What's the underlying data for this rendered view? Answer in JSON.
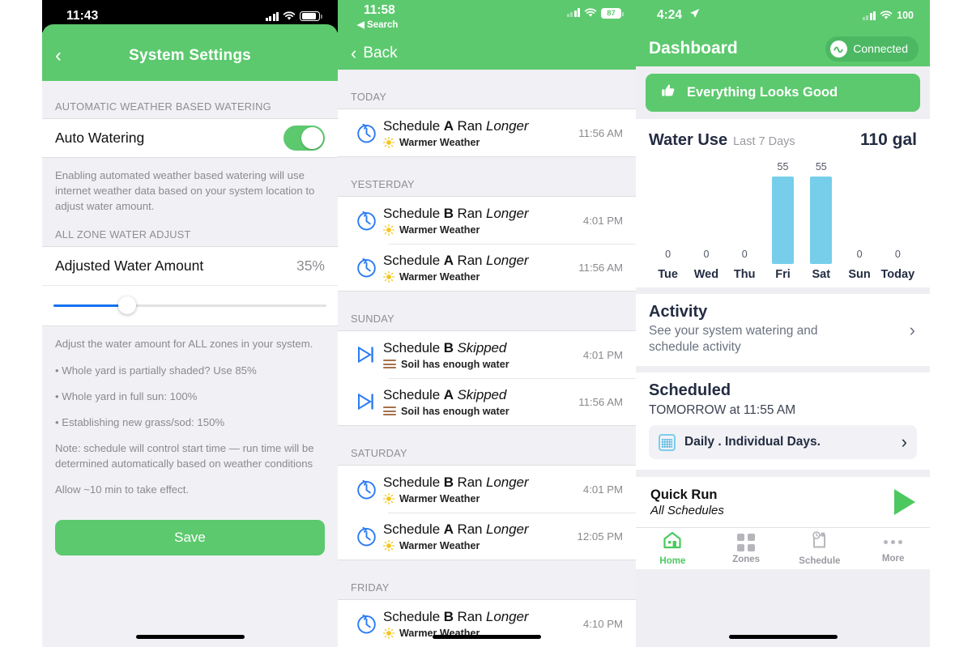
{
  "panel1": {
    "status": {
      "time": "11:43",
      "signal_icon": "cellular-signal-icon",
      "wifi_icon": "wifi-icon",
      "battery_icon": "battery-icon"
    },
    "nav": {
      "back_icon": "chevron-left-icon",
      "title": "System Settings"
    },
    "section1_header": "AUTOMATIC WEATHER BASED WATERING",
    "auto_watering": {
      "label": "Auto Watering",
      "toggle_state": "on"
    },
    "help1": "Enabling automated weather based watering will use internet weather data based on your system location to adjust water amount.",
    "section2_header": "ALL ZONE WATER ADJUST",
    "adjust": {
      "label": "Adjusted Water Amount",
      "value": "35%",
      "slider_percent": 27
    },
    "help_lines": [
      "Adjust the water amount for ALL zones in your system.",
      "• Whole yard is partially shaded? Use 85%",
      "• Whole yard in full sun: 100%",
      "• Establishing new grass/sod: 150%",
      "Note: schedule will control start time — run time will be determined automatically based on weather conditions",
      "Allow ~10 min to take effect."
    ],
    "save_label": "Save"
  },
  "panel2": {
    "status": {
      "time": "11:58",
      "back_app": "◀ Search",
      "battery_percent": "87"
    },
    "nav": {
      "back_icon": "chevron-left-icon",
      "back_label": "Back"
    },
    "groups": [
      {
        "day": "TODAY",
        "events": [
          {
            "icon": "clock-ran-longer-icon",
            "schedule": "Schedule",
            "name": "A",
            "action": "Ran",
            "state": "Longer",
            "reason": "Warmer Weather",
            "reason_icon": "sun-icon",
            "time": "11:56 AM"
          }
        ]
      },
      {
        "day": "YESTERDAY",
        "events": [
          {
            "icon": "clock-ran-longer-icon",
            "schedule": "Schedule",
            "name": "B",
            "action": "Ran",
            "state": "Longer",
            "reason": "Warmer Weather",
            "reason_icon": "sun-icon",
            "time": "4:01 PM"
          },
          {
            "icon": "clock-ran-longer-icon",
            "schedule": "Schedule",
            "name": "A",
            "action": "Ran",
            "state": "Longer",
            "reason": "Warmer Weather",
            "reason_icon": "sun-icon",
            "time": "11:56 AM"
          }
        ]
      },
      {
        "day": "SUNDAY",
        "events": [
          {
            "icon": "skip-forward-icon",
            "schedule": "Schedule",
            "name": "B",
            "action": "",
            "state": "Skipped",
            "reason": "Soil has enough water",
            "reason_icon": "soil-icon",
            "time": "4:01 PM"
          },
          {
            "icon": "skip-forward-icon",
            "schedule": "Schedule",
            "name": "A",
            "action": "",
            "state": "Skipped",
            "reason": "Soil has enough water",
            "reason_icon": "soil-icon",
            "time": "11:56 AM"
          }
        ]
      },
      {
        "day": "SATURDAY",
        "events": [
          {
            "icon": "clock-ran-longer-icon",
            "schedule": "Schedule",
            "name": "B",
            "action": "Ran",
            "state": "Longer",
            "reason": "Warmer Weather",
            "reason_icon": "sun-icon",
            "time": "4:01 PM"
          },
          {
            "icon": "clock-ran-longer-icon",
            "schedule": "Schedule",
            "name": "A",
            "action": "Ran",
            "state": "Longer",
            "reason": "Warmer Weather",
            "reason_icon": "sun-icon",
            "time": "12:05 PM"
          }
        ]
      },
      {
        "day": "FRIDAY",
        "events": [
          {
            "icon": "clock-ran-longer-icon",
            "schedule": "Schedule",
            "name": "B",
            "action": "Ran",
            "state": "Longer",
            "reason": "Warmer Weather",
            "reason_icon": "sun-icon",
            "time": "4:10 PM"
          }
        ]
      }
    ]
  },
  "panel3": {
    "status": {
      "time": "4:24",
      "location_icon": "location-arrow-icon",
      "battery_percent": "100"
    },
    "nav": {
      "title": "Dashboard",
      "connected_label": "Connected",
      "connected_icon": "wave-icon"
    },
    "banner": {
      "icon": "thumbs-up-icon",
      "text": "Everything Looks Good"
    },
    "water_use": {
      "title": "Water Use",
      "subtitle": "Last 7 Days",
      "total": "110 gal"
    },
    "activity": {
      "title": "Activity",
      "desc": "See your system watering and schedule activity",
      "chevron_icon": "chevron-right-icon"
    },
    "scheduled": {
      "title": "Scheduled",
      "when": "TOMORROW at 11:55 AM",
      "item_label": "Daily . Individual Days.",
      "item_icon": "calendar-icon",
      "chevron_icon": "chevron-right-icon"
    },
    "quick_run": {
      "title": "Quick Run",
      "subtitle": "All Schedules",
      "play_icon": "play-icon"
    },
    "tabs": [
      {
        "label": "Home",
        "icon": "home-icon",
        "active": true
      },
      {
        "label": "Zones",
        "icon": "grid-icon",
        "active": false
      },
      {
        "label": "Schedule",
        "icon": "schedule-clock-icon",
        "active": false
      },
      {
        "label": "More",
        "icon": "ellipsis-icon",
        "active": false
      }
    ]
  },
  "chart_data": {
    "type": "bar",
    "title": "Water Use",
    "subtitle": "Last 7 Days",
    "categories": [
      "Tue",
      "Wed",
      "Thu",
      "Fri",
      "Sat",
      "Sun",
      "Today"
    ],
    "values": [
      0,
      0,
      0,
      55,
      55,
      0,
      0
    ],
    "value_labels": [
      "0",
      "0",
      "0",
      "55",
      "55",
      "0",
      "0"
    ],
    "total_label": "110 gal",
    "unit": "gal",
    "xlabel": "",
    "ylabel": "",
    "ylim": [
      0,
      60
    ],
    "grid": false,
    "legend": "none",
    "bar_color": "#76CEEA"
  },
  "colors": {
    "brand_green": "#5CC96E",
    "accent_blue": "#2B7BF3",
    "slider_blue": "#1572F1",
    "chart_blue": "#76CEEA",
    "soil_brown": "#A4714B",
    "sun_yellow": "#F5C518",
    "dark_navy": "#232C42"
  }
}
